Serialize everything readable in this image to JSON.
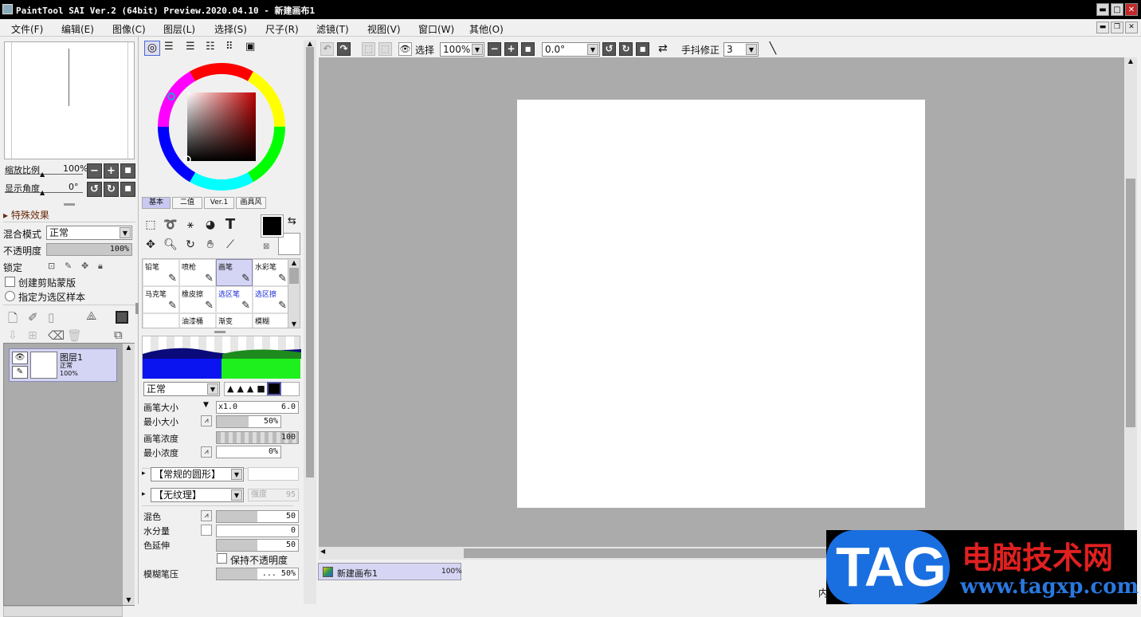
{
  "window": {
    "title": "PaintTool SAI Ver.2 (64bit) Preview.2020.04.10 - 新建画布1",
    "min": "▬",
    "max": "□",
    "close": "✕"
  },
  "menu": [
    "文件(F)",
    "编辑(E)",
    "图像(C)",
    "图层(L)",
    "选择(S)",
    "尺子(R)",
    "滤镜(T)",
    "视图(V)",
    "窗口(W)",
    "其他(O)"
  ],
  "navigator": {
    "zoom_label": "缩放比例",
    "zoom_value": "100%",
    "angle_label": "显示角度",
    "angle_value": "0°"
  },
  "layer_props": {
    "section": "特殊效果",
    "blend_label": "混合模式",
    "blend_value": "正常",
    "opacity_label": "不透明度",
    "opacity_value": "100%",
    "lock_label": "锁定",
    "clip_label": "创建剪贴蒙版",
    "selsrc_label": "指定为选区样本"
  },
  "layer": {
    "name": "图层1",
    "mode": "正常",
    "opacity": "100%"
  },
  "color_tabs": [
    "基本",
    "二值",
    "Ver.1",
    "画具风"
  ],
  "brushes": [
    {
      "label": "铅笔",
      "blue": false,
      "on": false
    },
    {
      "label": "喷枪",
      "blue": false,
      "on": false
    },
    {
      "label": "画笔",
      "blue": false,
      "on": true
    },
    {
      "label": "水彩笔",
      "blue": false,
      "on": false
    },
    {
      "label": "马克笔",
      "blue": false,
      "on": false
    },
    {
      "label": "橡皮擦",
      "blue": false,
      "on": false
    },
    {
      "label": "选区笔",
      "blue": true,
      "on": false
    },
    {
      "label": "选区擦",
      "blue": true,
      "on": false
    },
    {
      "label": "",
      "blue": false,
      "on": false
    },
    {
      "label": "油漆桶",
      "blue": false,
      "on": false
    },
    {
      "label": "渐变",
      "blue": false,
      "on": false
    },
    {
      "label": "模糊",
      "blue": false,
      "on": false
    }
  ],
  "brush_settings": {
    "mode": "正常",
    "size_label": "画笔大小",
    "size_mult": "x1.0",
    "size_value": "6.0",
    "minsize_label": "最小大小",
    "minsize_value": "50%",
    "density_label": "画笔浓度",
    "density_value": "100",
    "mindensity_label": "最小浓度",
    "mindensity_value": "0%",
    "shape": "【常规的圆形】",
    "texture": "【无纹理】",
    "texture_strength_label": "强度",
    "texture_strength": "95",
    "mix_label": "混色",
    "mix_value": "50",
    "water_label": "水分量",
    "water_value": "0",
    "stretch_label": "色延伸",
    "stretch_value": "50",
    "keep_opacity_label": "保持不透明度",
    "blur_label": "模糊笔压",
    "blur_value": "... 50%"
  },
  "canvas_toolbar": {
    "select_label": "选择",
    "zoom": "100%",
    "angle": "0.0°",
    "stabilizer_label": "手抖修正",
    "stabilizer": "3"
  },
  "doc": {
    "name": "新建画布1",
    "zoom": "100%"
  },
  "status_partial": "内",
  "watermark": {
    "tag": "TAG",
    "cn": "电脑技术网",
    "url": "www.tagxp.com"
  },
  "colors": {
    "fg": "#000000",
    "bg": "#ffffff",
    "brush_preview_left": "#0a14f0",
    "brush_preview_right": "#1ef01e"
  }
}
